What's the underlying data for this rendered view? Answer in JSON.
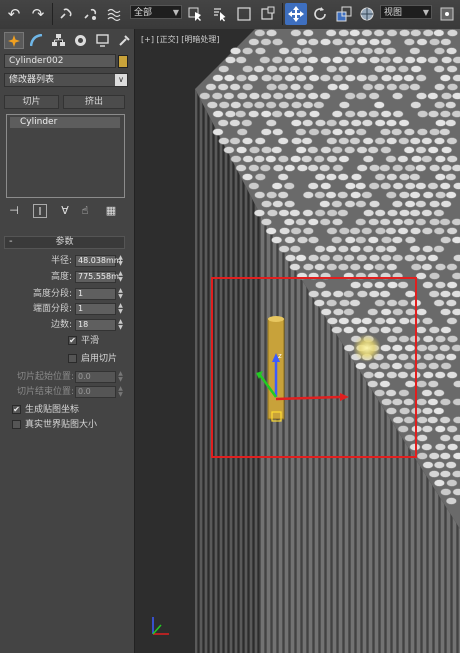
{
  "toolbar": {
    "selection_filter": "全部",
    "view_dropdown": "视图",
    "icons": [
      "undo-icon",
      "redo-icon",
      "link-icon",
      "unlink-icon",
      "bind-spacewarp-icon",
      "select-icon",
      "select-by-name-icon",
      "rect-region-icon",
      "window-crossing-icon",
      "move-icon",
      "rotate-icon",
      "scale-icon",
      "ref-coord-icon"
    ]
  },
  "command_panel": {
    "tabs": [
      "create-tab",
      "modify-tab",
      "hierarchy-tab",
      "motion-tab",
      "display-tab",
      "utilities-tab"
    ],
    "object_name": "Cylinder002",
    "object_color": "#c9a33a",
    "modifier_list": "修改器列表",
    "buttons": {
      "slice": "切片",
      "extrude": "挤出"
    },
    "stack_item": "Cylinder",
    "rollout_title": "参数",
    "params": [
      {
        "label": "半径:",
        "value": "48.038mm"
      },
      {
        "label": "高度:",
        "value": "775.558m"
      },
      {
        "label": "高度分段:",
        "value": "1"
      },
      {
        "label": "端面分段:",
        "value": "1"
      },
      {
        "label": "边数:",
        "value": "18"
      }
    ],
    "smooth": {
      "label": "平滑",
      "checked": "✔"
    },
    "slice_on": {
      "label": "启用切片",
      "checked": ""
    },
    "slice_from": {
      "label": "切片起始位置:",
      "value": "0.0"
    },
    "slice_to": {
      "label": "切片结束位置:",
      "value": "0.0"
    },
    "gen_mapping": {
      "label": "生成贴图坐标",
      "checked": "✔"
    },
    "real_world": {
      "label": "真实世界贴图大小",
      "checked": ""
    }
  },
  "viewport": {
    "label": "[+] [正交] [明暗处理]",
    "selection_box_color": "#e11f1f",
    "gizmo_axis_label": "z"
  }
}
